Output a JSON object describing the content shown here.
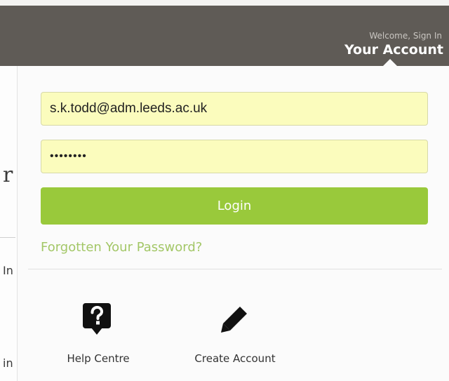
{
  "header": {
    "welcome_text": "Welcome, Sign In",
    "account_title": "Your Account"
  },
  "login_form": {
    "email_value": "s.k.todd@adm.leeds.ac.uk",
    "password_value": "••••••••",
    "login_label": "Login",
    "forgot_label": "Forgotten Your Password?"
  },
  "quick_links": [
    {
      "label": "Help Centre",
      "icon": "help-question-icon"
    },
    {
      "label": "Create Account",
      "icon": "pencil-icon"
    }
  ],
  "background_fragments": {
    "heading_char": "r",
    "line1_char": "In",
    "line2_char": "in"
  },
  "colors": {
    "header_bg": "#5f5b56",
    "input_bg": "#fbfcbd",
    "login_button": "#99c93b",
    "link_green": "#a3c767"
  }
}
